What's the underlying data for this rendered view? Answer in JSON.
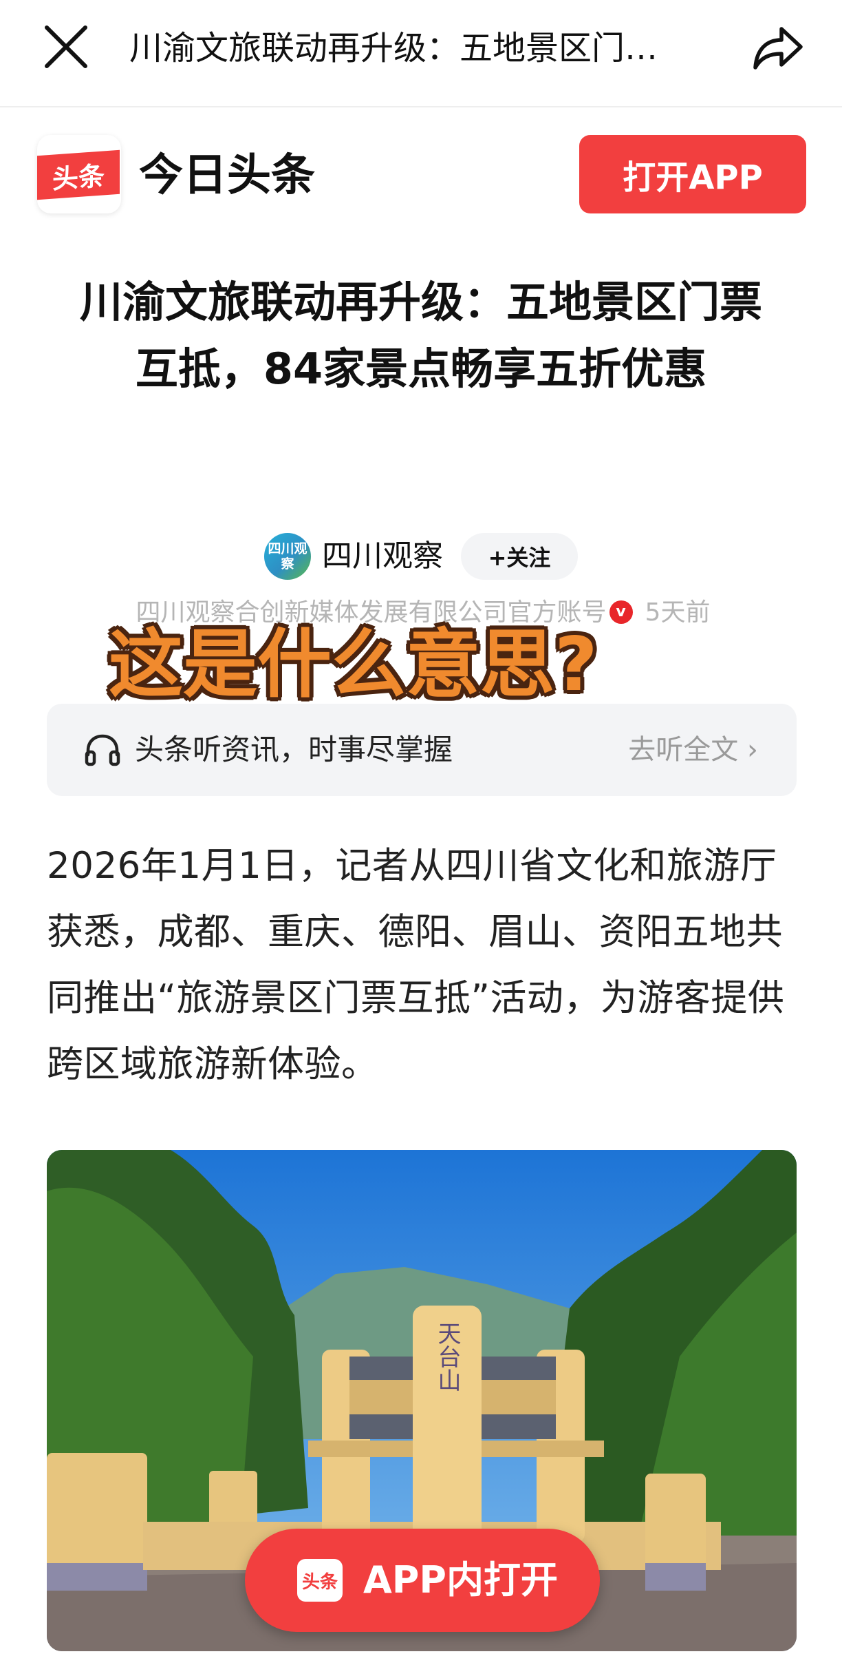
{
  "nav": {
    "title": "川渝文旅联动再升级：五地景区门…",
    "close_icon": "close-icon",
    "share_icon": "share-icon"
  },
  "brand": {
    "logo_text": "头条",
    "name": "今日头条",
    "open_app_label": "打开APP",
    "accent_color": "#f23f3f"
  },
  "article": {
    "title": "川渝文旅联动再升级：五地景区门票互抵，84家景点畅享五折优惠",
    "body": "2026年1月1日，记者从四川省文化和旅游厅获悉，成都、重庆、德阳、眉山、资阳五地共同推出“旅游景区门票互抵”活动，为游客提供跨区域旅游新体验。"
  },
  "author": {
    "avatar_text": "四川观察",
    "name": "四川观察",
    "follow_label": "+关注",
    "description": "四川观察合创新媒体发展有限公司官方账号",
    "verified_mark": "v",
    "time": "5天前"
  },
  "overlay": {
    "caption": "这是什么意思?"
  },
  "listen": {
    "icon": "headphone-icon",
    "text": "头条听资讯，时事尽掌握",
    "link_label": "去听全文 ›"
  },
  "image": {
    "gate_inscription": "天台山"
  },
  "float_button": {
    "logo_text": "头条",
    "label": "APP内打开"
  }
}
